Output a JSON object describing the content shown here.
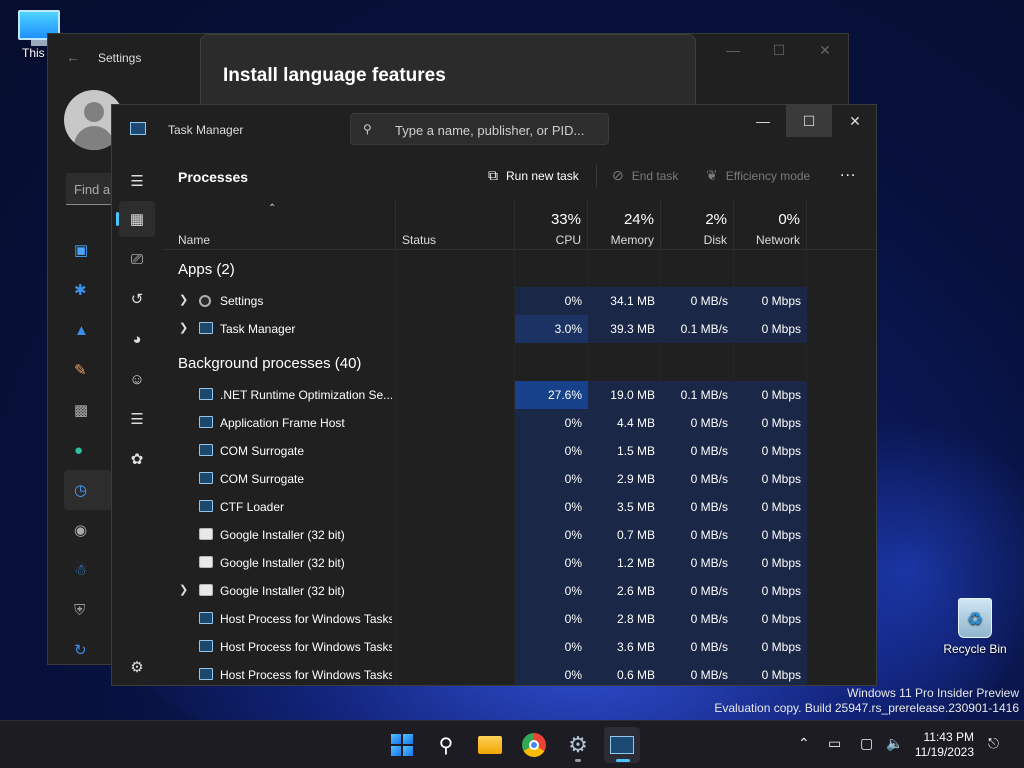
{
  "desktop": {
    "this_pc_label": "This P",
    "recycle_bin_label": "Recycle Bin",
    "watermark_line1": "Windows 11 Pro Insider Preview",
    "watermark_line2": "Evaluation copy. Build 25947.rs_prerelease.230901-1416"
  },
  "settings": {
    "title": "Settings",
    "find_placeholder": "Find a",
    "dialog_title": "Install language features",
    "nav_icons": [
      "system-icon",
      "bluetooth-icon",
      "network-icon",
      "personalization-icon",
      "apps-icon",
      "accounts-icon",
      "time-language-icon",
      "gaming-icon",
      "accessibility-icon",
      "privacy-icon",
      "windows-update-icon"
    ]
  },
  "task_manager": {
    "title": "Task Manager",
    "search_placeholder": "Type a name, publisher, or PID...",
    "page_title": "Processes",
    "toolbar": {
      "run_new_task": "Run new task",
      "end_task": "End task",
      "efficiency_mode": "Efficiency mode",
      "more": "..."
    },
    "columns": {
      "name": "Name",
      "status": "Status",
      "cpu_pct": "33%",
      "cpu": "CPU",
      "memory_pct": "24%",
      "memory": "Memory",
      "disk_pct": "2%",
      "disk": "Disk",
      "network_pct": "0%",
      "network": "Network"
    },
    "groups": {
      "apps": "Apps (2)",
      "background": "Background processes (40)"
    },
    "apps": [
      {
        "name": "Settings",
        "cpu": "0%",
        "memory": "34.1 MB",
        "disk": "0 MB/s",
        "network": "0 Mbps",
        "icon": "gear-icon",
        "expandable": true
      },
      {
        "name": "Task Manager",
        "cpu": "3.0%",
        "memory": "39.3 MB",
        "disk": "0.1 MB/s",
        "network": "0 Mbps",
        "icon": "task-manager-icon",
        "expandable": true
      }
    ],
    "background": [
      {
        "name": ".NET Runtime Optimization Se...",
        "cpu": "27.6%",
        "memory": "19.0 MB",
        "disk": "0.1 MB/s",
        "network": "0 Mbps",
        "icon": "process-icon",
        "expandable": false
      },
      {
        "name": "Application Frame Host",
        "cpu": "0%",
        "memory": "4.4 MB",
        "disk": "0 MB/s",
        "network": "0 Mbps",
        "icon": "process-icon",
        "expandable": false
      },
      {
        "name": "COM Surrogate",
        "cpu": "0%",
        "memory": "1.5 MB",
        "disk": "0 MB/s",
        "network": "0 Mbps",
        "icon": "process-icon",
        "expandable": false
      },
      {
        "name": "COM Surrogate",
        "cpu": "0%",
        "memory": "2.9 MB",
        "disk": "0 MB/s",
        "network": "0 Mbps",
        "icon": "process-icon",
        "expandable": false
      },
      {
        "name": "CTF Loader",
        "cpu": "0%",
        "memory": "3.5 MB",
        "disk": "0 MB/s",
        "network": "0 Mbps",
        "icon": "process-icon",
        "expandable": false
      },
      {
        "name": "Google Installer (32 bit)",
        "cpu": "0%",
        "memory": "0.7 MB",
        "disk": "0 MB/s",
        "network": "0 Mbps",
        "icon": "google-installer-icon",
        "expandable": false
      },
      {
        "name": "Google Installer (32 bit)",
        "cpu": "0%",
        "memory": "1.2 MB",
        "disk": "0 MB/s",
        "network": "0 Mbps",
        "icon": "google-installer-icon",
        "expandable": false
      },
      {
        "name": "Google Installer (32 bit)",
        "cpu": "0%",
        "memory": "2.6 MB",
        "disk": "0 MB/s",
        "network": "0 Mbps",
        "icon": "google-installer-icon",
        "expandable": true
      },
      {
        "name": "Host Process for Windows Tasks",
        "cpu": "0%",
        "memory": "2.8 MB",
        "disk": "0 MB/s",
        "network": "0 Mbps",
        "icon": "process-icon",
        "expandable": false
      },
      {
        "name": "Host Process for Windows Tasks",
        "cpu": "0%",
        "memory": "3.6 MB",
        "disk": "0 MB/s",
        "network": "0 Mbps",
        "icon": "process-icon",
        "expandable": false
      },
      {
        "name": "Host Process for Windows Tasks",
        "cpu": "0%",
        "memory": "0.6 MB",
        "disk": "0 MB/s",
        "network": "0 Mbps",
        "icon": "process-icon",
        "expandable": false
      }
    ]
  },
  "taskbar": {
    "time": "11:43 PM",
    "date": "11/19/2023",
    "apps": [
      "start-icon",
      "search-icon",
      "file-explorer-icon",
      "chrome-icon",
      "settings-icon",
      "task-manager-icon"
    ]
  },
  "colors": {
    "accent": "#4cc2ff",
    "heat_hot": "#17418a",
    "heat_warm": "#1b3262",
    "heat_cool": "#1a2746"
  }
}
